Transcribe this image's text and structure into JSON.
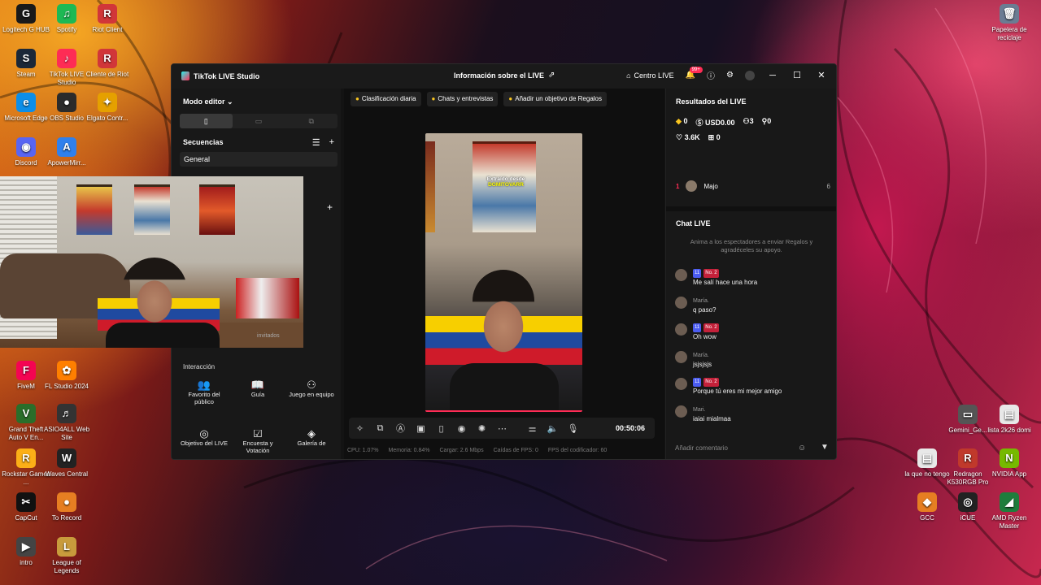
{
  "desktop": {
    "left_icons": [
      {
        "label": "Logitech G HUB",
        "icon": "logitech-icon",
        "glyph": "G",
        "color": "#1a1a1a"
      },
      {
        "label": "Spotify",
        "icon": "spotify-icon",
        "glyph": "♫",
        "color": "#1db954"
      },
      {
        "label": "Riot Client",
        "icon": "riot-icon",
        "glyph": "R",
        "color": "#d13639"
      },
      {
        "label": "Steam",
        "icon": "steam-icon",
        "glyph": "S",
        "color": "#1b2838"
      },
      {
        "label": "TikTok LIVE Studio",
        "icon": "tiktok-icon",
        "glyph": "♪",
        "color": "#fe2c55"
      },
      {
        "label": "Cliente de Riot",
        "icon": "riot-icon",
        "glyph": "R",
        "color": "#d13639"
      },
      {
        "label": "Microsoft Edge",
        "icon": "edge-icon",
        "glyph": "e",
        "color": "#0c8ee8"
      },
      {
        "label": "OBS Studio",
        "icon": "obs-icon",
        "glyph": "●",
        "color": "#2b2b2b"
      },
      {
        "label": "Elgato Contr...",
        "icon": "elgato-icon",
        "glyph": "✦",
        "color": "#e5a000"
      },
      {
        "label": "Discord",
        "icon": "discord-icon",
        "glyph": "◉",
        "color": "#5865f2"
      },
      {
        "label": "ApowerMirr...",
        "icon": "apowermirror-icon",
        "glyph": "A",
        "color": "#2f80ed"
      },
      {
        "label": "FiveM",
        "icon": "fivem-icon",
        "glyph": "F",
        "color": "#f40552"
      },
      {
        "label": "FL Studio 2024",
        "icon": "flstudio-icon",
        "glyph": "✿",
        "color": "#ff7f00"
      },
      {
        "label": "Grand Theft Auto V En...",
        "icon": "gta-icon",
        "glyph": "V",
        "color": "#2a6e2a"
      },
      {
        "label": "ASIO4ALL Web Site",
        "icon": "asio-icon",
        "glyph": "♬",
        "color": "#333333"
      },
      {
        "label": "Rockstar Games ...",
        "icon": "rockstar-icon",
        "glyph": "R",
        "color": "#fcaf17"
      },
      {
        "label": "Waves Central",
        "icon": "waves-icon",
        "glyph": "W",
        "color": "#222222"
      },
      {
        "label": "CapCut",
        "icon": "capcut-icon",
        "glyph": "✂",
        "color": "#111111"
      },
      {
        "label": "To Record",
        "icon": "record-icon",
        "glyph": "●",
        "color": "#e67e22"
      },
      {
        "label": "intro",
        "icon": "video-file-icon",
        "glyph": "▶",
        "color": "#444444"
      },
      {
        "label": "League of Legends",
        "icon": "lol-icon",
        "glyph": "L",
        "color": "#c89b3c"
      }
    ],
    "right_icons": [
      {
        "label": "Papelera de reciclaje",
        "icon": "recycle-bin-icon",
        "glyph": "🗑",
        "color": "#6b7c93"
      },
      {
        "label": "Gemini_Ge...",
        "icon": "image-file-icon",
        "glyph": "▭",
        "color": "#555555"
      },
      {
        "label": "lista 2k26 domi",
        "icon": "text-file-icon",
        "glyph": "▤",
        "color": "#e8e8e8"
      },
      {
        "label": "la que no tengo",
        "icon": "text-file-icon",
        "glyph": "▤",
        "color": "#e8e8e8"
      },
      {
        "label": "Redragon K530RGB Pro",
        "icon": "redragon-icon",
        "glyph": "R",
        "color": "#c0392b"
      },
      {
        "label": "NVIDIA App",
        "icon": "nvidia-icon",
        "glyph": "N",
        "color": "#76b900"
      },
      {
        "label": "GCC",
        "icon": "gcc-icon",
        "glyph": "◆",
        "color": "#e67e22"
      },
      {
        "label": "iCUE",
        "icon": "icue-icon",
        "glyph": "◎",
        "color": "#222222"
      },
      {
        "label": "AMD Ryzen Master",
        "icon": "amd-icon",
        "glyph": "◢",
        "color": "#1e7d3c"
      }
    ]
  },
  "window": {
    "app_title": "TikTok LIVE Studio",
    "center_title": "Información sobre el LIVE",
    "centro_live": "Centro LIVE",
    "notif_badge": "99+"
  },
  "left_panel": {
    "modo_editor": "Modo editor",
    "secuencias": "Secuencias",
    "seq_item": "General",
    "interaccion": "Interacción",
    "tiles": [
      "Favorito del público",
      "Guía",
      "Juego en equipo",
      "Objetivo del LIVE",
      "Encuesta y Votación",
      "Galería de"
    ],
    "cut_text": "invitados"
  },
  "center_panel": {
    "pills": [
      "Clasificación diaria",
      "Chats y entrevistas",
      "Añadir un objetivo de Regalos"
    ],
    "overlay_line1": "Extraído desde",
    "overlay_line2": "DOMITOVARR",
    "timer": "00:50:06",
    "stats": [
      "CPU: 1.07%",
      "Memoria: 0.84%",
      "Cargar: 2.6 Mbps",
      "Caídas de FPS: 0",
      "FPS del codificador: 60"
    ]
  },
  "right_panel": {
    "resultados": "Resultados del LIVE",
    "row1": [
      "0",
      "USD0.00",
      "3",
      "0"
    ],
    "row2": [
      "3.6K",
      "0"
    ],
    "rank": {
      "n": "1",
      "name": "Majo",
      "count": "6"
    },
    "chat_title": "Chat LIVE",
    "hint": "Anima a los espectadores a enviar Regalos y agradéceles su apoyo.",
    "messages": [
      {
        "name": "",
        "lv": "11",
        "no2": "No. 2",
        "text": "Me salí hace una hora"
      },
      {
        "name": "María.",
        "lv": "",
        "no2": "",
        "text": "q paso?"
      },
      {
        "name": "",
        "lv": "11",
        "no2": "No. 2",
        "text": "Oh wow"
      },
      {
        "name": "María.",
        "lv": "",
        "no2": "",
        "text": "jsjsjsjs"
      },
      {
        "name": "",
        "lv": "11",
        "no2": "No. 2",
        "text": "Porque tú eres mi mejor amigo"
      },
      {
        "name": "Mari.",
        "lv": "",
        "no2": "",
        "text": "jajaj mialmaa"
      }
    ],
    "comment_placeholder": "Añadir comentario"
  }
}
